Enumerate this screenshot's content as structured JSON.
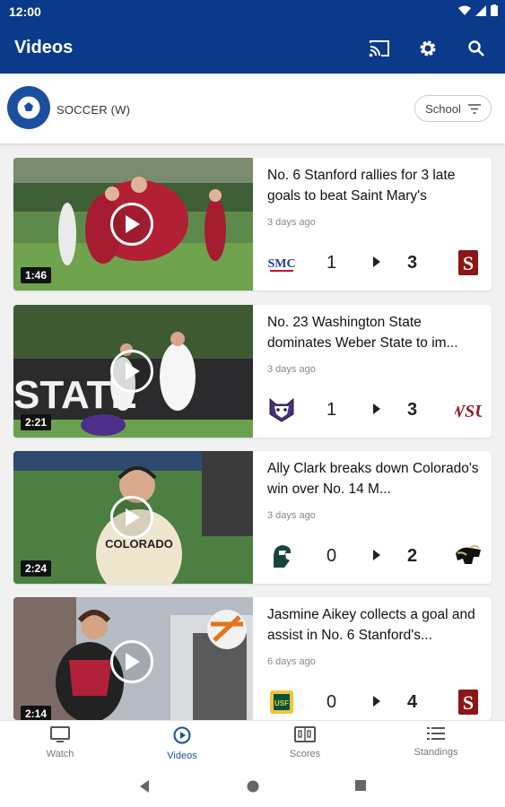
{
  "status": {
    "time": "12:00"
  },
  "appbar": {
    "title": "Videos"
  },
  "sport": {
    "name": "SOCCER (W)",
    "filter_label": "School"
  },
  "videos": [
    {
      "headline": "No. 6 Stanford rallies for 3 late goals to beat Saint Mary's",
      "age": "3 days ago",
      "duration": "1:46",
      "away_score": "1",
      "home_score": "3",
      "away_logo": "SMC",
      "home_logo": "S"
    },
    {
      "headline": "No. 23 Washington State dominates Weber State to im...",
      "age": "3 days ago",
      "duration": "2:21",
      "away_score": "1",
      "home_score": "3",
      "thumb_text": "STATE",
      "away_logo": "wildcat",
      "home_logo": "WSU"
    },
    {
      "headline": "Ally Clark breaks down Colorado's win over No. 14 M...",
      "age": "3 days ago",
      "duration": "2:24",
      "away_score": "0",
      "home_score": "2",
      "thumb_text": "COLORADO",
      "away_logo": "spartan",
      "home_logo": "buffalo"
    },
    {
      "headline": "Jasmine Aikey collects a goal and assist in No. 6 Stanford's...",
      "age": "6 days ago",
      "duration": "2:14",
      "away_score": "0",
      "home_score": "4",
      "away_logo": "USF",
      "home_logo": "S"
    }
  ],
  "nav": [
    {
      "label": "Watch",
      "icon": "tv-icon"
    },
    {
      "label": "Videos",
      "icon": "play-circle-icon"
    },
    {
      "label": "Scores",
      "icon": "scoreboard-icon"
    },
    {
      "label": "Standings",
      "icon": "list-icon"
    }
  ],
  "colors": {
    "primary": "#0b3a8a",
    "stanford": "#8c1515",
    "wsu": "#981e32",
    "msu": "#18453b",
    "colorado": "#cfb87c"
  }
}
